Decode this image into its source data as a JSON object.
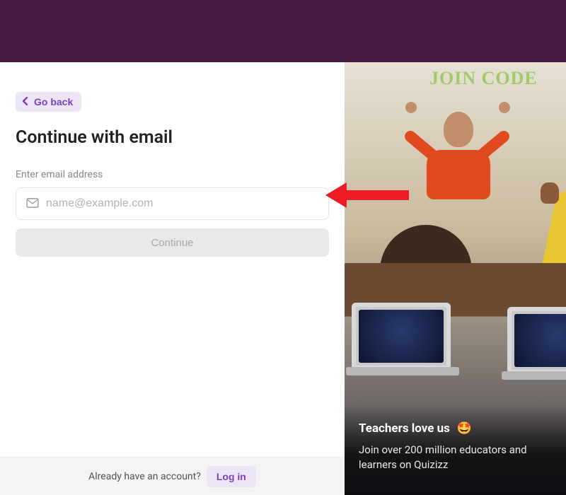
{
  "nav": {
    "go_back_label": "Go back"
  },
  "title": "Continue with email",
  "email": {
    "label": "Enter email address",
    "placeholder": "name@example.com"
  },
  "continue_label": "Continue",
  "footer": {
    "prompt": "Already have an account?",
    "login_label": "Log in"
  },
  "promo": {
    "board_text": "JOIN CODE",
    "title": "Teachers love us",
    "emoji": "🤩",
    "subtitle": "Join over 200 million educators and learners on Quizizz"
  }
}
